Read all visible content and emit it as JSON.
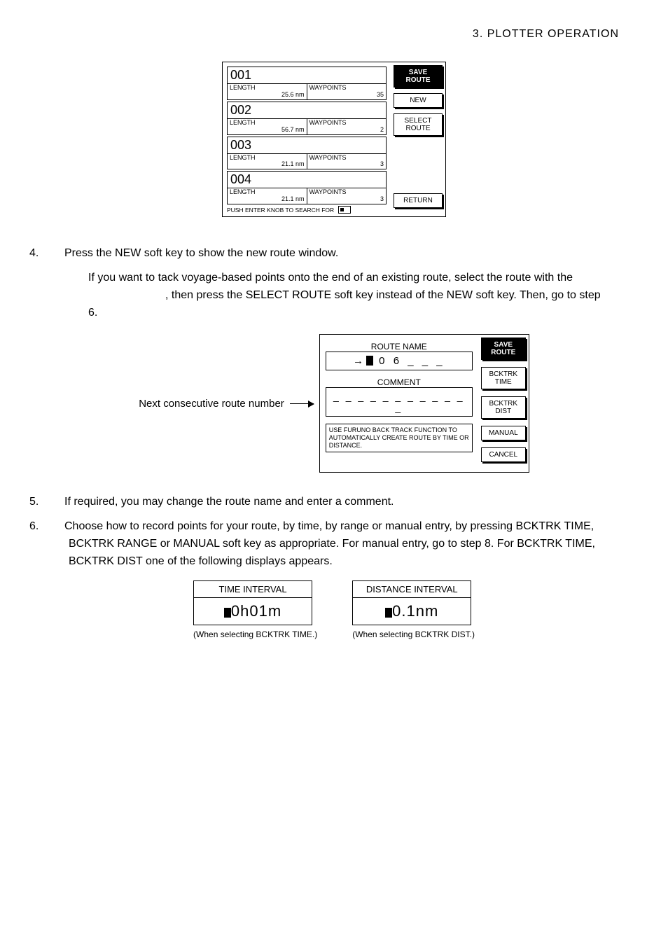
{
  "header": {
    "section": "3.  PLOTTER  OPERATION"
  },
  "fig1": {
    "routes": [
      {
        "id": "001",
        "length_label": "LENGTH",
        "length_val": "25.6 nm",
        "wp_label": "WAYPOINTS",
        "wp_val": "35"
      },
      {
        "id": "002",
        "length_label": "LENGTH",
        "length_val": "56.7 nm",
        "wp_label": "WAYPOINTS",
        "wp_val": "2"
      },
      {
        "id": "003",
        "length_label": "LENGTH",
        "length_val": "21.1 nm",
        "wp_label": "WAYPOINTS",
        "wp_val": "3"
      },
      {
        "id": "004",
        "length_label": "LENGTH",
        "length_val": "21.1 nm",
        "wp_label": "WAYPOINTS",
        "wp_val": "3"
      }
    ],
    "hint": "PUSH ENTER KNOB TO SEARCH FOR",
    "softkeys": {
      "save_route_l1": "SAVE",
      "save_route_l2": "ROUTE",
      "new": "NEW",
      "select_l1": "SELECT",
      "select_l2": "ROUTE",
      "return": "RETURN"
    }
  },
  "steps": {
    "s4": "Press the NEW soft key to show the new route window.",
    "s4_note_a": "If you want to tack voyage-based points onto the end of an existing route, select the route with the",
    "s4_note_b": ", then press the SELECT ROUTE soft key instead of the NEW soft key. Then, go to step 6.",
    "s5": "If required, you may change the route name and enter a comment.",
    "s6": "Choose how to record points for your route, by time, by range or manual entry, by pressing BCKTRK TIME, BCKTRK RANGE or MANUAL soft key as appropriate. For manual entry, go to step 8. For BCKTRK TIME, BCKTRK DIST one of the following displays appears."
  },
  "fig2": {
    "pointer_label": "Next consecutive route number",
    "route_name_label": "ROUTE NAME",
    "route_name_value": " 0 6 _ _ _",
    "comment_label": "COMMENT",
    "comment_value": "_ _ _ _ _ _ _ _ _ _ _ _",
    "instruction": "USE FURUNO BACK TRACK FUNCTION TO AUTOMATICALLY CREATE ROUTE BY TIME OR DISTANCE.",
    "softkeys": {
      "save_l1": "SAVE",
      "save_l2": "ROUTE",
      "bt_time_l1": "BCKTRK",
      "bt_time_l2": "TIME",
      "bt_dist_l1": "BCKTRK",
      "bt_dist_l2": "DIST",
      "manual": "MANUAL",
      "cancel": "CANCEL"
    }
  },
  "fig3": {
    "time": {
      "title": "TIME INTERVAL",
      "value": "0h01m",
      "caption": "(When selecting BCKTRK TIME.)"
    },
    "dist": {
      "title": "DISTANCE INTERVAL",
      "value": "0.1nm",
      "caption": "(When selecting BCKTRK DIST.)"
    }
  }
}
